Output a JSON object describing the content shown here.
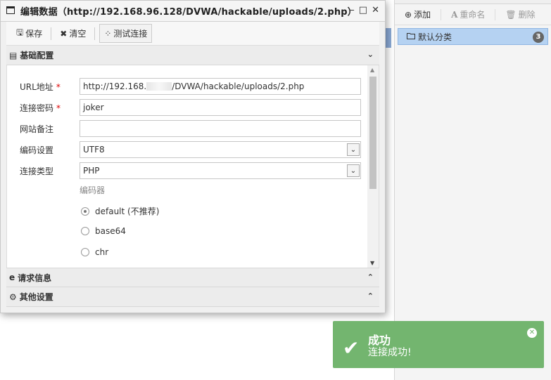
{
  "dialog": {
    "title": "编辑数据（http://192.168.96.128/DVWA/hackable/uploads/2.php）",
    "controls": {
      "minimize": "–",
      "maximize": "□",
      "close": "✕"
    }
  },
  "toolbar": {
    "save_label": "保存",
    "clear_label": "清空",
    "test_label": "测试连接"
  },
  "sections": {
    "basic": "基础配置",
    "request": "请求信息",
    "other": "其他设置"
  },
  "form": {
    "url": {
      "label": "URL地址",
      "value_prefix": "http://192.168.",
      "value_suffix": "/DVWA/hackable/uploads/2.php"
    },
    "password": {
      "label": "连接密码",
      "value": "joker"
    },
    "note": {
      "label": "网站备注",
      "value": ""
    },
    "encoding": {
      "label": "编码设置",
      "value": "UTF8"
    },
    "type": {
      "label": "连接类型",
      "value": "PHP"
    },
    "encoder": {
      "title": "编码器",
      "options": [
        "default (不推荐)",
        "base64",
        "chr"
      ],
      "selected": "default (不推荐)"
    }
  },
  "right_panel": {
    "add_label": "添加",
    "rename_label": "重命名",
    "delete_label": "删除",
    "tree": [
      {
        "label": "默认分类",
        "count": "3"
      }
    ]
  },
  "toast": {
    "title": "成功",
    "message": "连接成功!"
  }
}
